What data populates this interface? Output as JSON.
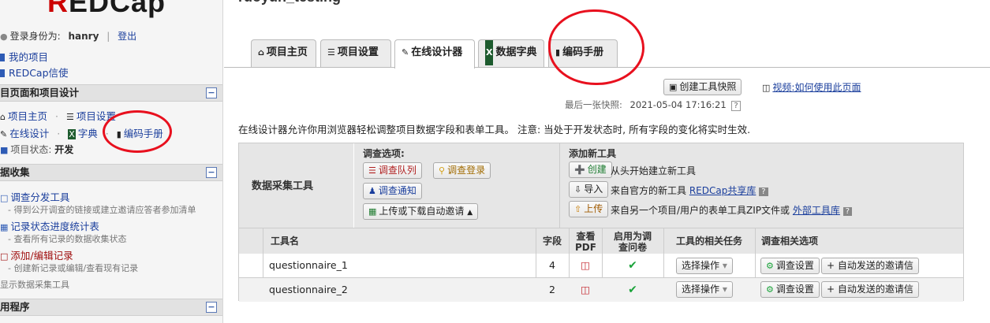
{
  "sidebar": {
    "logo_prefix": "R",
    "logo_rest": "EDCap",
    "login_label": "登录身份为:",
    "username": "hanry",
    "logout": "登出",
    "my_projects": "我的项目",
    "redcap_messages": "REDCap信使",
    "sections": {
      "project_home": "目页面和项目设计",
      "data_collection": "据收集",
      "applications": "用程序"
    },
    "project_links": {
      "home": "项目主页",
      "setup": "项目设置",
      "designer": "在线设计",
      "dictionary": "字典",
      "codebook": "编码手册",
      "status_label": "项目状态:",
      "status_value": "开发"
    },
    "collection": {
      "survey_dist": "调查分发工具",
      "survey_dist_desc": "- 得到公开调查的链接或建立邀请应答者参加清单",
      "record_status": "记录状态进度统计表",
      "record_status_desc": "- 查看所有记录的数据收集状态",
      "add_edit": "添加/编辑记录",
      "add_edit_desc": "- 创建新记录或编辑/查看现有记录",
      "show_instruments": "显示数据采集工具"
    }
  },
  "main": {
    "title": "ruoyun_testing",
    "tabs": [
      "项目主页",
      "项目设置",
      "在线设计器",
      "数据字典",
      "编码手册"
    ],
    "snapshot_btn": "创建工具快照",
    "video_link": "视频:如何使用此页面",
    "last_snapshot_label": "最后一张快照:",
    "last_snapshot_time": "2021-05-04 17:16:21",
    "help": "?",
    "description": "在线设计器允许你用浏览器轻松调整项目数据字段和表单工具。 注意: 当处于开发状态时, 所有字段的变化将实时生效.",
    "instr_header": "数据采集工具",
    "survey_options_label": "调查选项:",
    "survey_queue": "调查队列",
    "survey_login": "调查登录",
    "survey_notify": "调查通知",
    "auto_invite": "上传或下载自动邀请",
    "add_tool_label": "添加新工具",
    "create_btn": "创建",
    "create_desc": "从头开始建立新工具",
    "import_btn": "导入",
    "import_desc": "来自官方的新工具",
    "import_link": "REDCap共享库",
    "upload_btn": "上传",
    "upload_desc": "来自另一个项目/用户的表单工具ZIP文件或",
    "upload_link": "外部工具库",
    "columns": [
      "工具名",
      "字段",
      "查看PDF",
      "启用为调查问卷",
      "工具的相关任务",
      "调查相关选项"
    ],
    "rows": [
      {
        "name": "questionnaire_1",
        "fields": "4"
      },
      {
        "name": "questionnaire_2",
        "fields": "2"
      }
    ],
    "select_action": "选择操作",
    "survey_settings": "调查设置",
    "auto_invitations": "+ 自动发送的邀请信"
  },
  "colors": {
    "accent": "#1a3e9c",
    "annotation": "#e8101e",
    "pdf": "#c4262e",
    "enabled": "#1aa33a"
  }
}
